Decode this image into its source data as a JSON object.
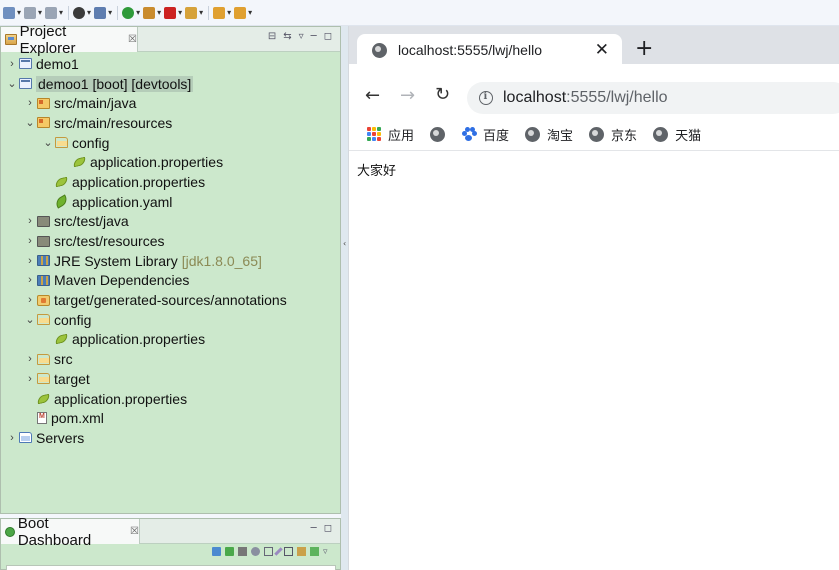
{
  "colors": {
    "explorer_bg": "#cce8cc",
    "selection": "#b5cdb9",
    "browser_tabstrip": "#dee1e6",
    "omnibox_bg": "#f1f3f4",
    "library_version_text": "#8b8a55",
    "accent_blue": "#2f6fe4"
  },
  "toolbar": {
    "icons": [
      "new-icon",
      "save-icon",
      "save-all-icon",
      "debug-icon",
      "open-type-icon",
      "run-icon",
      "external-tools-icon",
      "stop-icon",
      "search-icon",
      "back-icon",
      "forward-icon"
    ]
  },
  "explorer": {
    "title": "Project Explorer",
    "close_glyph": "☒",
    "tree": [
      {
        "label": "demo1",
        "depth": 0,
        "twisty": "›",
        "icon": "project-icon",
        "iconClass": "project"
      },
      {
        "label": "demoo1 [boot] [devtools]",
        "depth": 0,
        "twisty": "⌄",
        "icon": "project-icon",
        "iconClass": "project",
        "selected": true
      },
      {
        "label": "src/main/java",
        "depth": 1,
        "twisty": "›",
        "icon": "source-folder-icon",
        "iconClass": "srcfolder"
      },
      {
        "label": "src/main/resources",
        "depth": 1,
        "twisty": "⌄",
        "icon": "source-folder-icon",
        "iconClass": "srcfolder"
      },
      {
        "label": "config",
        "depth": 2,
        "twisty": "⌄",
        "icon": "folder-icon",
        "iconClass": "folder"
      },
      {
        "label": "application.properties",
        "depth": 3,
        "twisty": "",
        "icon": "spring-properties-icon",
        "iconClass": "leaf"
      },
      {
        "label": "application.properties",
        "depth": 2,
        "twisty": "",
        "icon": "spring-properties-icon",
        "iconClass": "leaf"
      },
      {
        "label": "application.yaml",
        "depth": 2,
        "twisty": "",
        "icon": "spring-yaml-icon",
        "iconClass": "yaml"
      },
      {
        "label": "src/test/java",
        "depth": 1,
        "twisty": "›",
        "icon": "test-folder-icon",
        "iconClass": "testfolder"
      },
      {
        "label": "src/test/resources",
        "depth": 1,
        "twisty": "›",
        "icon": "test-folder-icon",
        "iconClass": "testfolder"
      },
      {
        "label": "JRE System Library",
        "hint": "[jdk1.8.0_65]",
        "depth": 1,
        "twisty": "›",
        "icon": "library-icon",
        "iconClass": "library"
      },
      {
        "label": "Maven Dependencies",
        "depth": 1,
        "twisty": "›",
        "icon": "library-icon",
        "iconClass": "library"
      },
      {
        "label": "target/generated-sources/annotations",
        "depth": 1,
        "twisty": "›",
        "icon": "package-folder-icon",
        "iconClass": "pkg"
      },
      {
        "label": "config",
        "depth": 1,
        "twisty": "⌄",
        "icon": "folder-icon",
        "iconClass": "folder"
      },
      {
        "label": "application.properties",
        "depth": 2,
        "twisty": "",
        "icon": "spring-properties-icon",
        "iconClass": "leaf"
      },
      {
        "label": "src",
        "depth": 1,
        "twisty": "›",
        "icon": "folder-icon",
        "iconClass": "folder"
      },
      {
        "label": "target",
        "depth": 1,
        "twisty": "›",
        "icon": "folder-icon",
        "iconClass": "folder"
      },
      {
        "label": "application.properties",
        "depth": 1,
        "twisty": "",
        "icon": "spring-properties-icon",
        "iconClass": "leaf"
      },
      {
        "label": "pom.xml",
        "depth": 1,
        "twisty": "",
        "icon": "maven-pom-icon",
        "iconClass": "xml"
      },
      {
        "label": "Servers",
        "depth": 0,
        "twisty": "›",
        "icon": "servers-folder-icon",
        "iconClass": "servers"
      }
    ]
  },
  "boot_dashboard": {
    "title": "Boot Dashboard",
    "close_glyph": "☒"
  },
  "browser": {
    "tab_title": "localhost:5555/lwj/hello",
    "tab_close": "✕",
    "new_tab": "+",
    "back": "←",
    "forward": "→",
    "reload": "↻",
    "url_host": "localhost",
    "url_rest": ":5555/lwj/hello",
    "bookmarks": [
      {
        "label": "应用",
        "icon": "apps-icon"
      },
      {
        "label": "",
        "icon": "globe-icon"
      },
      {
        "label": "百度",
        "icon": "baidu-paw-icon"
      },
      {
        "label": "淘宝",
        "icon": "globe-icon"
      },
      {
        "label": "京东",
        "icon": "globe-icon"
      },
      {
        "label": "天猫",
        "icon": "globe-icon"
      }
    ],
    "page_text": "大家好"
  }
}
